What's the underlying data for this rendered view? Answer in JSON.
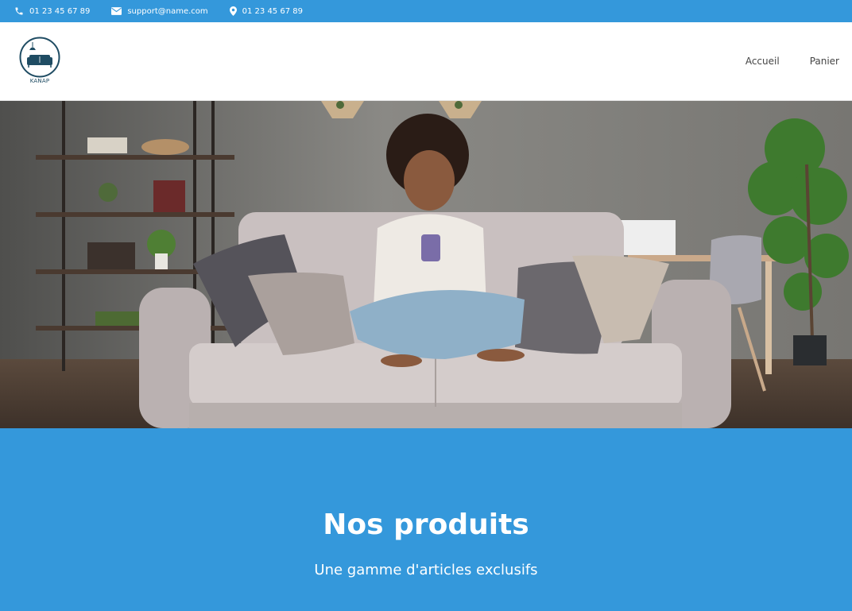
{
  "topbar": {
    "phone": "01 23 45 67 89",
    "email": "support@name.com",
    "address": "01 23 45 67 89"
  },
  "header": {
    "logo_text": "KANAP",
    "nav": [
      "Accueil",
      "Panier"
    ]
  },
  "products": {
    "title": "Nos produits",
    "subtitle": "Une gamme d'articles exclusifs"
  },
  "colors": {
    "accent": "#3498db"
  }
}
